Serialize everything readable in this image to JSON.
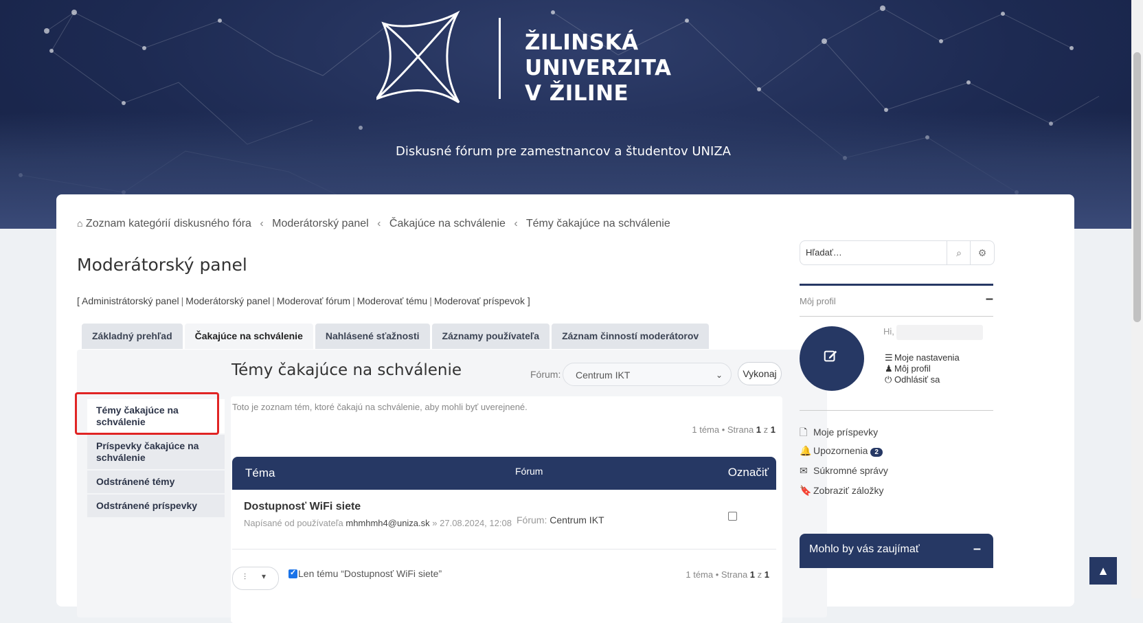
{
  "header": {
    "university_name_line1": "ŽILINSKÁ UNIVERZITA",
    "university_name_line2": "V ŽILINE",
    "subtitle": "Diskusné fórum pre zamestnancov a študentov UNIZA"
  },
  "breadcrumb": [
    "Zoznam kategórií diskusného fóra",
    "Moderátorský panel",
    "Čakajúce na schválenie",
    "Témy čakajúce na schválenie"
  ],
  "page_title": "Moderátorský panel",
  "admin_links": [
    "Administrátorský panel",
    "Moderátorský panel",
    "Moderovať fórum",
    "Moderovať tému",
    "Moderovať príspevok"
  ],
  "tabs": [
    {
      "label": "Základný prehľad",
      "active": false
    },
    {
      "label": "Čakajúce na schválenie",
      "active": true
    },
    {
      "label": "Nahlásené sťažnosti",
      "active": false
    },
    {
      "label": "Záznamy používateľa",
      "active": false
    },
    {
      "label": "Záznam činností moderátorov",
      "active": false
    }
  ],
  "side_nav": [
    {
      "label": "Témy čakajúce na schválenie",
      "active": true
    },
    {
      "label": "Príspevky čakajúce na schválenie",
      "active": false
    },
    {
      "label": "Odstránené témy",
      "active": false
    },
    {
      "label": "Odstránené príspevky",
      "active": false
    }
  ],
  "section": {
    "title": "Témy čakajúce na schválenie",
    "forum_label": "Fórum:",
    "forum_selected": "Centrum IKT",
    "go_button": "Vykonaj",
    "description": "Toto je zoznam tém, ktoré čakajú na schválenie, aby mohli byť uverejnené.",
    "pagination": {
      "count_text": "1 téma • Strana ",
      "current": "1",
      "of": " z ",
      "total": "1"
    }
  },
  "table": {
    "headers": {
      "topic": "Téma",
      "forum": "Fórum",
      "mark": "Označiť"
    },
    "rows": [
      {
        "title": "Dostupnosť WiFi siete",
        "posted_by_prefix": "Napísané od používateľa",
        "author": "mhmhmh4@uniza.sk",
        "date": "» 27.08.2024, 12:08",
        "forum_prefix": "Fórum:",
        "forum": "Centrum IKT",
        "checked": false
      }
    ]
  },
  "bottom": {
    "only_topic_label": "Len tému “Dostupnosť WiFi siete”",
    "only_topic_checked": true
  },
  "search": {
    "placeholder": "Hľadať…"
  },
  "profile": {
    "section_title": "Môj profil",
    "greeting": "Hi,",
    "links": [
      "Moje nastavenia",
      "Môj profil",
      "Odhlásiť sa"
    ]
  },
  "quick_links": [
    {
      "label": "Moje príspevky",
      "icon": "file-icon"
    },
    {
      "label": "Upozornenia",
      "icon": "bell-icon",
      "badge": "2"
    },
    {
      "label": "Súkromné správy",
      "icon": "inbox-icon"
    },
    {
      "label": "Zobraziť záložky",
      "icon": "bookmark-icon"
    }
  ],
  "interest_box": {
    "title": "Mohlo by vás zaujímať"
  },
  "colors": {
    "primary": "#263864",
    "highlight": "#e02424"
  }
}
